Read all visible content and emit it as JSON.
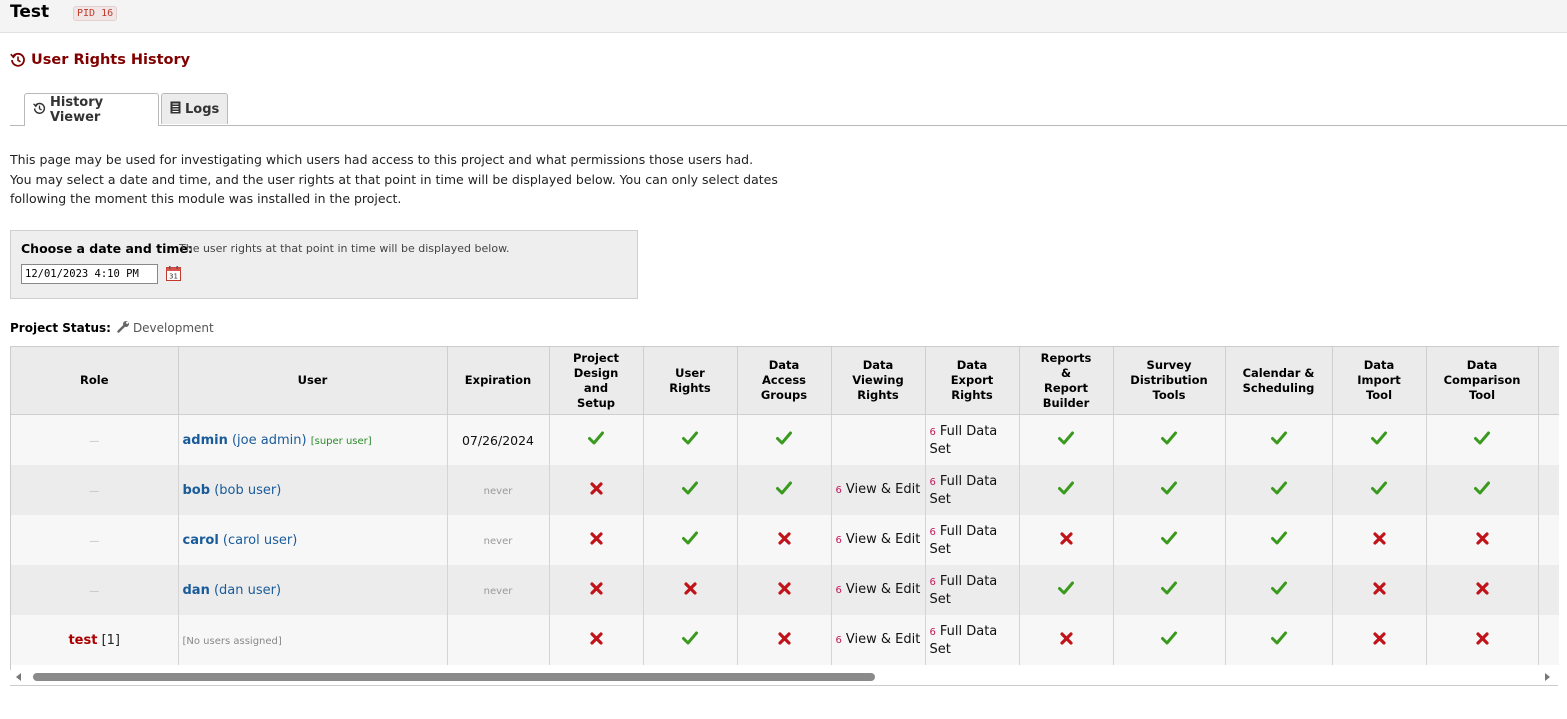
{
  "header": {
    "project_title": "Test",
    "pid_label": "PID 16"
  },
  "page": {
    "title": "User Rights History"
  },
  "tabs": [
    {
      "label": "History Viewer",
      "active": true,
      "icon": "history-icon"
    },
    {
      "label": "Logs",
      "active": false,
      "icon": "document-icon"
    }
  ],
  "intro": {
    "line1": "This page may be used for investigating which users had access to this project and what permissions those users had.",
    "line2": "You may select a date and time, and the user rights at that point in time will be displayed below. You can only select dates",
    "line3": "following the moment this module was installed in the project."
  },
  "datebox": {
    "label": "Choose a date and time:",
    "hint": "The user rights at that point in time will be displayed below.",
    "value": "12/01/2023 4:10 PM"
  },
  "project_status": {
    "label": "Project Status:",
    "value": "Development"
  },
  "table": {
    "headers": {
      "role": "Role",
      "user": "User",
      "expiration": "Expiration",
      "design": [
        "Project",
        "Design",
        "and",
        "Setup"
      ],
      "user_rights": [
        "User",
        "Rights"
      ],
      "dag": [
        "Data",
        "Access",
        "Groups"
      ],
      "viewing": [
        "Data",
        "Viewing",
        "Rights"
      ],
      "export": [
        "Data",
        "Export",
        "Rights"
      ],
      "reports": [
        "Reports",
        "&",
        "Report",
        "Builder"
      ],
      "survey": [
        "Survey",
        "Distribution",
        "Tools"
      ],
      "calendar": [
        "Calendar &",
        "Scheduling"
      ],
      "import": [
        "Data",
        "Import",
        "Tool"
      ],
      "comparison": [
        "Data",
        "Comparison",
        "Tool"
      ]
    },
    "rows": [
      {
        "role": "—",
        "username": "admin",
        "fullname": "(joe admin)",
        "tag": "[super user]",
        "expiration": "07/26/2024",
        "design": true,
        "user_rights": true,
        "dag": true,
        "viewing_num": "",
        "viewing_text": "",
        "export_num": "6",
        "export_text": "Full Data Set",
        "reports": true,
        "survey": true,
        "calendar": true,
        "import": true,
        "comparison": true
      },
      {
        "role": "—",
        "username": "bob",
        "fullname": "(bob user)",
        "tag": "",
        "expiration": "never",
        "design": false,
        "user_rights": true,
        "dag": true,
        "viewing_num": "6",
        "viewing_text": "View & Edit",
        "export_num": "6",
        "export_text": "Full Data Set",
        "reports": true,
        "survey": true,
        "calendar": true,
        "import": true,
        "comparison": true
      },
      {
        "role": "—",
        "username": "carol",
        "fullname": "(carol user)",
        "tag": "",
        "expiration": "never",
        "design": false,
        "user_rights": true,
        "dag": false,
        "viewing_num": "6",
        "viewing_text": "View & Edit",
        "export_num": "6",
        "export_text": "Full Data Set",
        "reports": false,
        "survey": true,
        "calendar": true,
        "import": false,
        "comparison": false
      },
      {
        "role": "—",
        "username": "dan",
        "fullname": "(dan user)",
        "tag": "",
        "expiration": "never",
        "design": false,
        "user_rights": false,
        "dag": false,
        "viewing_num": "6",
        "viewing_text": "View & Edit",
        "export_num": "6",
        "export_text": "Full Data Set",
        "reports": true,
        "survey": true,
        "calendar": true,
        "import": false,
        "comparison": false
      },
      {
        "role": "test",
        "role_count": "[1]",
        "username": "",
        "fullname": "",
        "tag": "",
        "nouser": "[No users assigned]",
        "expiration": "",
        "design": false,
        "user_rights": true,
        "dag": false,
        "viewing_num": "6",
        "viewing_text": "View & Edit",
        "export_num": "6",
        "export_text": "Full Data Set",
        "reports": false,
        "survey": true,
        "calendar": true,
        "import": false,
        "comparison": false
      }
    ]
  },
  "colors": {
    "check": "#3a9a1e",
    "cross": "#c0141a",
    "role": "#aa0000",
    "link": "#1a5b9a"
  }
}
